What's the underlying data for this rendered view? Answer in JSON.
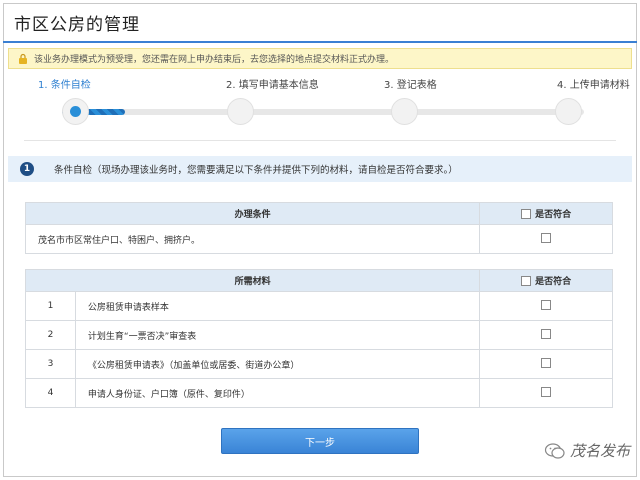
{
  "header": {
    "title": "市区公房的管理"
  },
  "notice": {
    "text": "该业务办理模式为预受理，您还需在网上申办结束后，去您选择的地点提交材料正式办理。"
  },
  "steps": {
    "items": [
      {
        "label": "1. 条件自检",
        "active": true
      },
      {
        "label": "2. 填写申请基本信息",
        "active": false
      },
      {
        "label": "3. 登记表格",
        "active": false
      },
      {
        "label": "4. 上传申请材料",
        "active": false
      }
    ],
    "progress": 0.12,
    "accent": "#2a8fd8"
  },
  "section": {
    "number": "1",
    "text": "条件自检（现场办理该业务时，您需要满足以下条件并提供下列的材料，请自检是否符合要求。）"
  },
  "conditions_table": {
    "header_label": "办理条件",
    "check_label": "是否符合",
    "rows": [
      {
        "text": "茂名市市区常住户口、特困户、拥挤户。"
      }
    ]
  },
  "materials_table": {
    "header_label": "所需材料",
    "check_label": "是否符合",
    "rows": [
      {
        "no": "1",
        "text": "公房租赁申请表样本"
      },
      {
        "no": "2",
        "text": "计划生育“一票否决”审查表"
      },
      {
        "no": "3",
        "text": "《公房租赁申请表》（加盖单位或居委、街道办公章）"
      },
      {
        "no": "4",
        "text": "申请人身份证、户口簿（原件、复印件）"
      }
    ]
  },
  "next_button": {
    "label": "下一步"
  },
  "watermark": {
    "text": "茂名发布",
    "icon": "wechat-icon"
  },
  "colors": {
    "primary": "#3b7fd2",
    "button": "#3a84d6",
    "notice_bg": "#fdf6c8"
  }
}
